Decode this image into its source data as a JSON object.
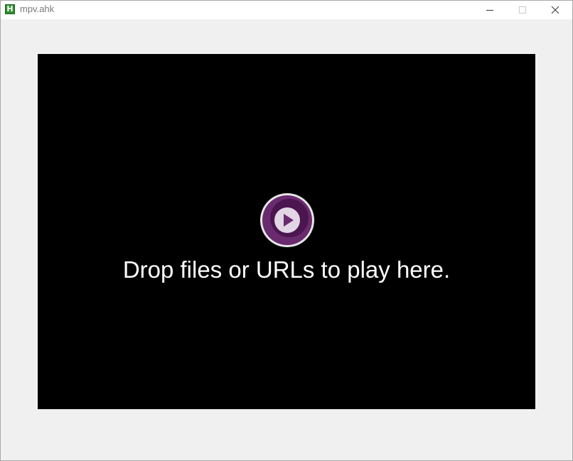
{
  "window": {
    "title": "mpv.ahk",
    "app_icon_letter": "H",
    "app_icon": "autohotkey-icon",
    "buttons": {
      "minimize": "minimize-icon",
      "maximize": "maximize-icon",
      "close": "close-icon"
    }
  },
  "player": {
    "logo": "mpv-play-logo-icon",
    "message": "Drop files or URLs to play here."
  },
  "colors": {
    "titlebar": "#ffffff",
    "client_area": "#f0f0f0",
    "video_area": "#000000",
    "logo_outer": "#6a2a6e",
    "logo_inner": "#3f0f45",
    "message_text": "#ffffff"
  }
}
